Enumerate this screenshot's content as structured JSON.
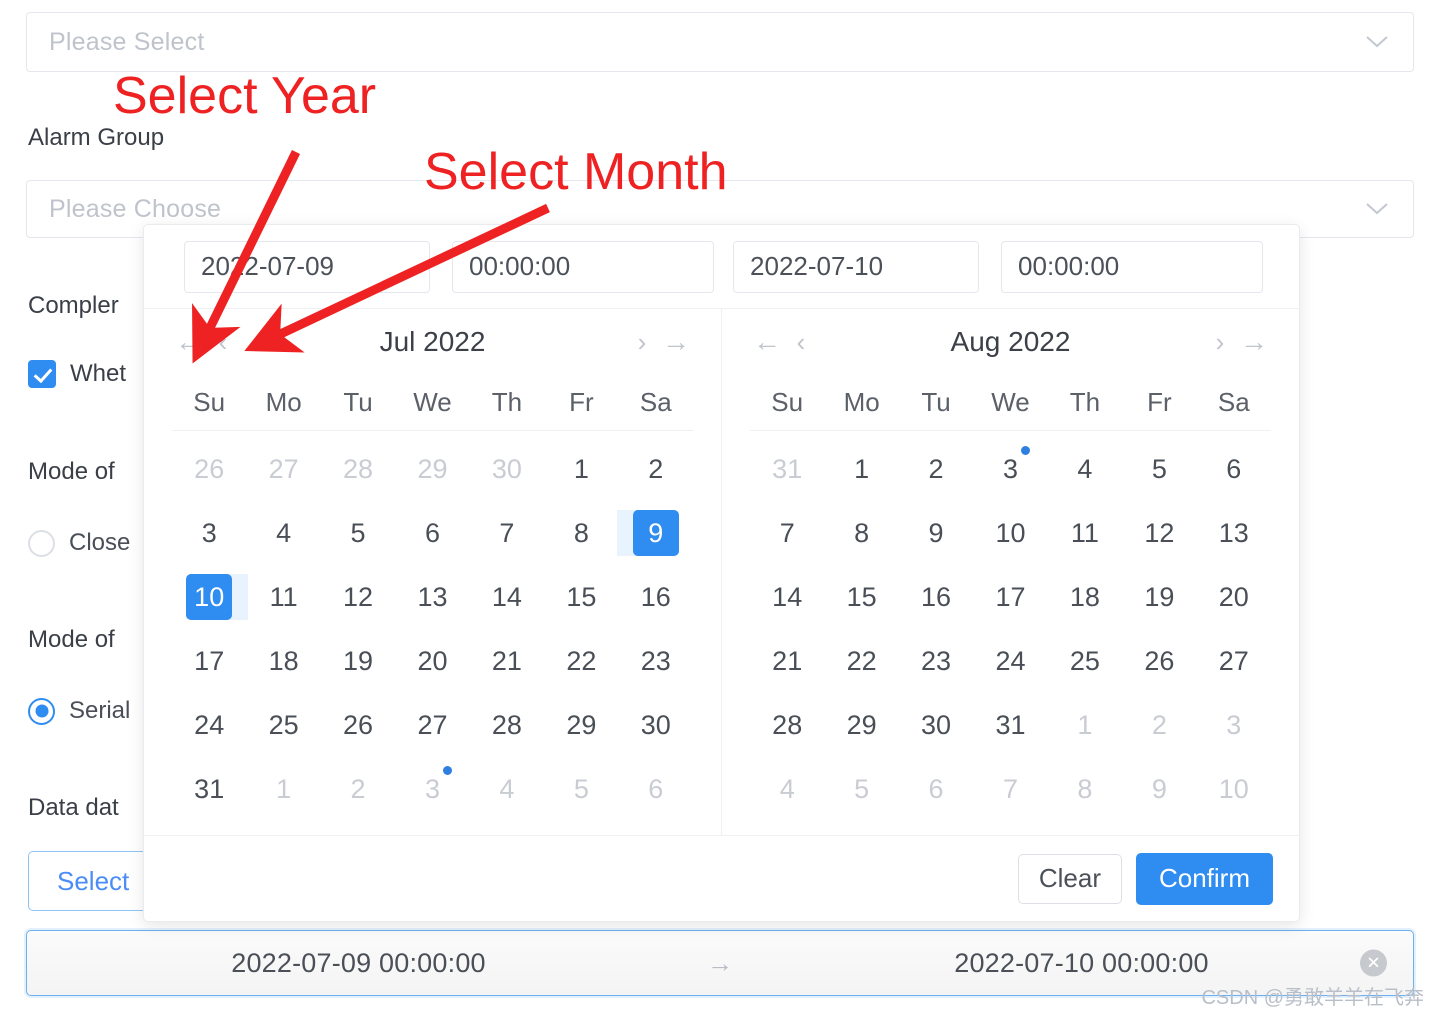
{
  "background_form": {
    "top_select": {
      "placeholder": "Please Select",
      "caret_icon": "chevron-down-icon"
    },
    "alarm_group_label": "Alarm Group",
    "alarm_group_select": {
      "placeholder": "Please Choose",
      "caret_icon": "chevron-down-icon"
    },
    "complete_label": "Compler",
    "whether_checkbox": {
      "label": "Whet",
      "checked": true
    },
    "mode_of_label_1": "Mode of",
    "close_radio": {
      "label": "Close",
      "selected": false
    },
    "mode_of_label_2": "Mode of",
    "serial_radio": {
      "label": "Serial",
      "selected": true
    },
    "data_date_label": "Data dat",
    "select_button_label": "Select"
  },
  "range_field": {
    "start_value": "2022-07-09 00:00:00",
    "end_value": "2022-07-10 00:00:00",
    "separator_icon": "arrow-right-icon",
    "clear_icon": "circle-close-icon",
    "clear_glyph": "✕"
  },
  "annotations": {
    "select_year": "Select Year",
    "select_month": "Select Month",
    "color": "#ee2222"
  },
  "picker": {
    "start_date_input": {
      "value": "2022-07-09"
    },
    "start_time_input": {
      "value": "00:00:00"
    },
    "end_date_input": {
      "value": "2022-07-10"
    },
    "end_time_input": {
      "value": "00:00:00"
    },
    "nav": {
      "prev_year": "←",
      "prev_month": "‹",
      "next_month": "›",
      "next_year": "→"
    },
    "left_calendar": {
      "title": "Jul 2022",
      "weekdays": [
        "Su",
        "Mo",
        "Tu",
        "We",
        "Th",
        "Fr",
        "Sa"
      ],
      "weeks": [
        [
          {
            "d": "26",
            "muted": true
          },
          {
            "d": "27",
            "muted": true
          },
          {
            "d": "28",
            "muted": true
          },
          {
            "d": "29",
            "muted": true
          },
          {
            "d": "30",
            "muted": true
          },
          {
            "d": "1"
          },
          {
            "d": "2"
          }
        ],
        [
          {
            "d": "3"
          },
          {
            "d": "4"
          },
          {
            "d": "5"
          },
          {
            "d": "6"
          },
          {
            "d": "7"
          },
          {
            "d": "8"
          },
          {
            "d": "9",
            "selected": true,
            "range": "end"
          }
        ],
        [
          {
            "d": "10",
            "selected": true,
            "range": "start"
          },
          {
            "d": "11"
          },
          {
            "d": "12"
          },
          {
            "d": "13"
          },
          {
            "d": "14"
          },
          {
            "d": "15"
          },
          {
            "d": "16"
          }
        ],
        [
          {
            "d": "17"
          },
          {
            "d": "18"
          },
          {
            "d": "19"
          },
          {
            "d": "20"
          },
          {
            "d": "21"
          },
          {
            "d": "22"
          },
          {
            "d": "23"
          }
        ],
        [
          {
            "d": "24"
          },
          {
            "d": "25"
          },
          {
            "d": "26"
          },
          {
            "d": "27"
          },
          {
            "d": "28"
          },
          {
            "d": "29"
          },
          {
            "d": "30"
          }
        ],
        [
          {
            "d": "31"
          },
          {
            "d": "1",
            "muted": true
          },
          {
            "d": "2",
            "muted": true
          },
          {
            "d": "3",
            "muted": true,
            "dot": true
          },
          {
            "d": "4",
            "muted": true
          },
          {
            "d": "5",
            "muted": true
          },
          {
            "d": "6",
            "muted": true
          }
        ]
      ]
    },
    "right_calendar": {
      "title": "Aug 2022",
      "weekdays": [
        "Su",
        "Mo",
        "Tu",
        "We",
        "Th",
        "Fr",
        "Sa"
      ],
      "weeks": [
        [
          {
            "d": "31",
            "muted": true
          },
          {
            "d": "1"
          },
          {
            "d": "2"
          },
          {
            "d": "3",
            "dot": true
          },
          {
            "d": "4"
          },
          {
            "d": "5"
          },
          {
            "d": "6"
          }
        ],
        [
          {
            "d": "7"
          },
          {
            "d": "8"
          },
          {
            "d": "9"
          },
          {
            "d": "10"
          },
          {
            "d": "11"
          },
          {
            "d": "12"
          },
          {
            "d": "13"
          }
        ],
        [
          {
            "d": "14"
          },
          {
            "d": "15"
          },
          {
            "d": "16"
          },
          {
            "d": "17"
          },
          {
            "d": "18"
          },
          {
            "d": "19"
          },
          {
            "d": "20"
          }
        ],
        [
          {
            "d": "21"
          },
          {
            "d": "22"
          },
          {
            "d": "23"
          },
          {
            "d": "24"
          },
          {
            "d": "25"
          },
          {
            "d": "26"
          },
          {
            "d": "27"
          }
        ],
        [
          {
            "d": "28"
          },
          {
            "d": "29"
          },
          {
            "d": "30"
          },
          {
            "d": "31"
          },
          {
            "d": "1",
            "muted": true
          },
          {
            "d": "2",
            "muted": true
          },
          {
            "d": "3",
            "muted": true
          }
        ],
        [
          {
            "d": "4",
            "muted": true
          },
          {
            "d": "5",
            "muted": true
          },
          {
            "d": "6",
            "muted": true
          },
          {
            "d": "7",
            "muted": true
          },
          {
            "d": "8",
            "muted": true
          },
          {
            "d": "9",
            "muted": true
          },
          {
            "d": "10",
            "muted": true
          }
        ]
      ]
    },
    "footer": {
      "clear_label": "Clear",
      "confirm_label": "Confirm"
    }
  },
  "watermark": "CSDN @勇敢羊羊在飞奔",
  "colors": {
    "accent": "#2f8cf0",
    "range_highlight": "#e9f3fe",
    "annotation_red": "#ee2222",
    "muted_text": "#c9ccd2"
  }
}
